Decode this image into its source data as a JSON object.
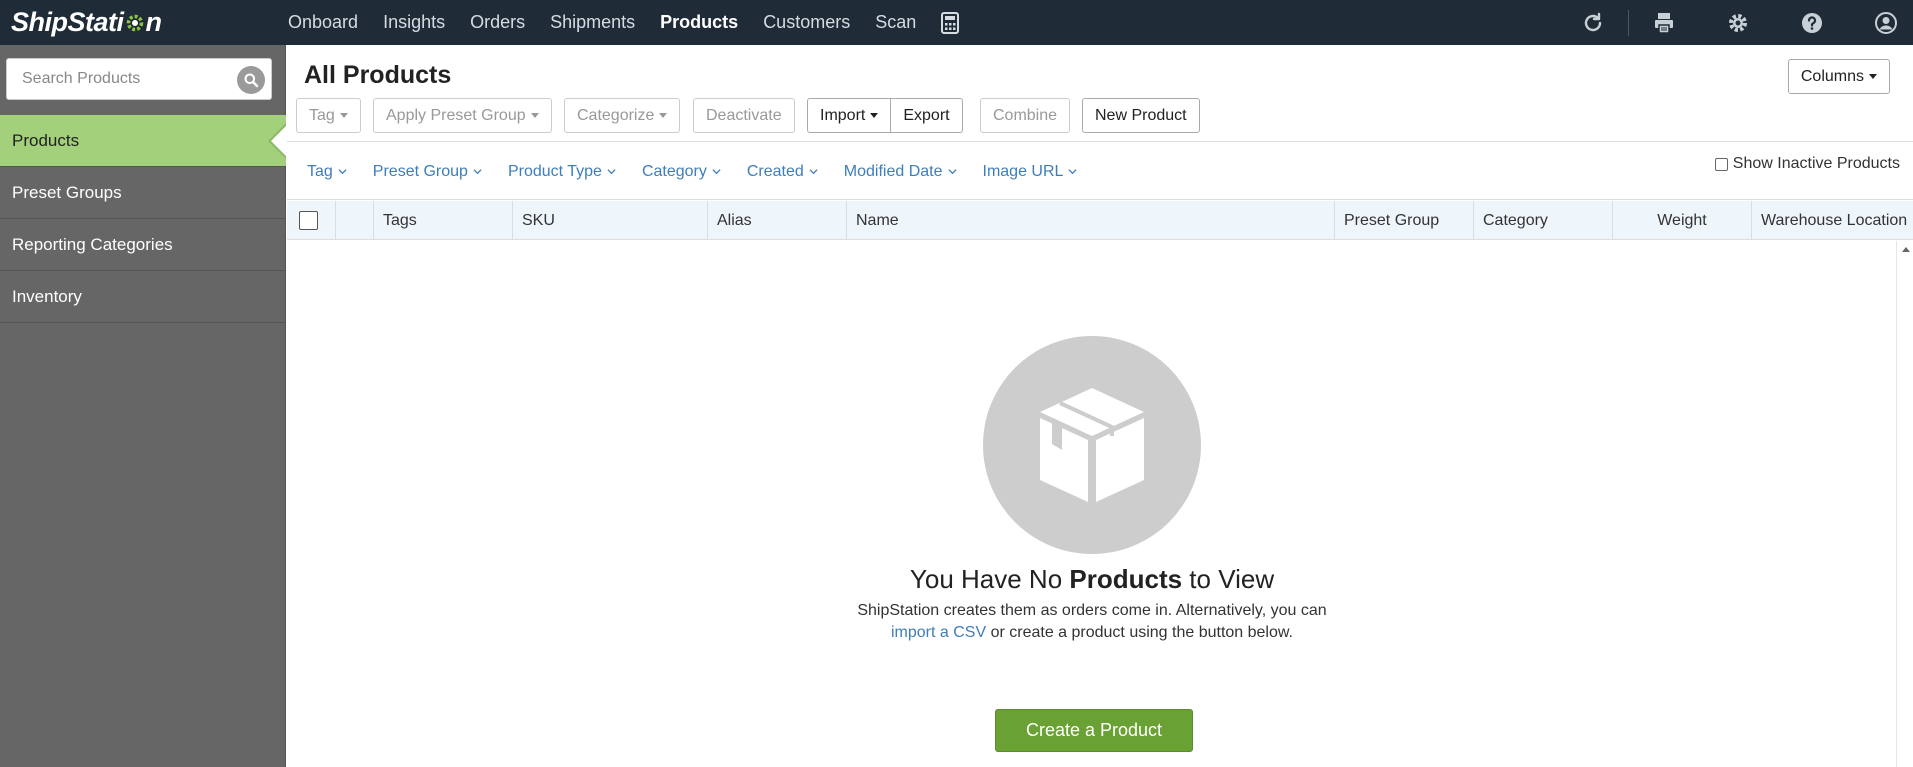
{
  "app": {
    "logo_text_a": "ShipStati",
    "logo_text_b": "n",
    "brand_colors": {
      "nav_bg": "#1f2b36",
      "accent_green": "#a3d07a",
      "button_green": "#6aa135",
      "link_blue": "#3d7ebb"
    }
  },
  "topnav": {
    "items": [
      {
        "label": "Onboard"
      },
      {
        "label": "Insights"
      },
      {
        "label": "Orders"
      },
      {
        "label": "Shipments"
      },
      {
        "label": "Products",
        "active": true
      },
      {
        "label": "Customers"
      },
      {
        "label": "Scan"
      }
    ],
    "icons": [
      "calculator-icon",
      "refresh-icon",
      "printer-icon",
      "gear-icon",
      "help-icon",
      "account-icon"
    ]
  },
  "sidebar": {
    "search_placeholder": "Search Products",
    "items": [
      {
        "label": "Products",
        "active": true
      },
      {
        "label": "Preset Groups"
      },
      {
        "label": "Reporting Categories"
      },
      {
        "label": "Inventory"
      }
    ]
  },
  "main": {
    "title": "All Products",
    "columns_button": "Columns",
    "toolbar": {
      "tag": "Tag",
      "apply_preset_group": "Apply Preset Group",
      "categorize": "Categorize",
      "deactivate": "Deactivate",
      "import": "Import",
      "export": "Export",
      "combine": "Combine",
      "new_product": "New Product"
    },
    "filters": [
      "Tag",
      "Preset Group",
      "Product Type",
      "Category",
      "Created",
      "Modified Date",
      "Image URL"
    ],
    "show_inactive_label": "Show Inactive Products",
    "table_headers": [
      "Tags",
      "SKU",
      "Alias",
      "Name",
      "Preset Group",
      "Category",
      "Weight",
      "Warehouse Location"
    ],
    "empty": {
      "title_pre": "You Have No ",
      "title_bold": "Products",
      "title_post": " to View",
      "text_1": "ShipStation creates them as orders come in. Alternatively, you can",
      "link": "import a CSV",
      "text_2": " or create a product using the button below.",
      "create_button": "Create a Product"
    }
  }
}
